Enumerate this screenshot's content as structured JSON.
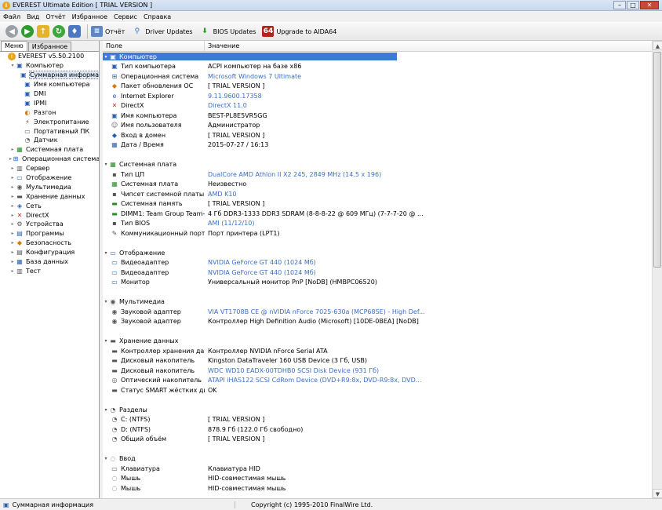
{
  "window": {
    "title": "EVEREST Ultimate Edition  [ TRIAL VERSION ]",
    "min": "–",
    "max": "□",
    "close": "✕"
  },
  "menu": [
    "Файл",
    "Вид",
    "Отчёт",
    "Избранное",
    "Сервис",
    "Справка"
  ],
  "toolbar": {
    "report": "Отчёт",
    "driver_updates": "Driver Updates",
    "bios_updates": "BIOS Updates",
    "upgrade": "Upgrade to AIDA64",
    "upgrade_icon": "64"
  },
  "left": {
    "tabs": [
      "Меню",
      "Избранное"
    ],
    "tree": [
      {
        "label": "EVEREST v5.50.2100",
        "icon": "everest-icon",
        "level": 0,
        "exp": ""
      },
      {
        "label": "Компьютер",
        "icon": "computer-icon",
        "level": 1,
        "exp": "▾"
      },
      {
        "label": "Суммарная информа",
        "icon": "summary-icon",
        "level": 2,
        "exp": "",
        "sel": true
      },
      {
        "label": "Имя компьютера",
        "icon": "computer-name-icon",
        "level": 2,
        "exp": ""
      },
      {
        "label": "DMI",
        "icon": "dmi-icon",
        "level": 2,
        "exp": ""
      },
      {
        "label": "IPMI",
        "icon": "ipmi-icon",
        "level": 2,
        "exp": ""
      },
      {
        "label": "Разгон",
        "icon": "overclock-icon",
        "level": 2,
        "exp": ""
      },
      {
        "label": "Электропитание",
        "icon": "power-icon",
        "level": 2,
        "exp": ""
      },
      {
        "label": "Портативный ПК",
        "icon": "laptop-icon",
        "level": 2,
        "exp": ""
      },
      {
        "label": "Датчик",
        "icon": "sensor-icon",
        "level": 2,
        "exp": ""
      },
      {
        "label": "Системная плата",
        "icon": "motherboard-icon",
        "level": 1,
        "exp": "▸"
      },
      {
        "label": "Операционная система",
        "icon": "os-icon",
        "level": 1,
        "exp": "▸"
      },
      {
        "label": "Сервер",
        "icon": "server-icon",
        "level": 1,
        "exp": "▸"
      },
      {
        "label": "Отображение",
        "icon": "display-icon",
        "level": 1,
        "exp": "▸"
      },
      {
        "label": "Мультимедиа",
        "icon": "multimedia-icon",
        "level": 1,
        "exp": "▸"
      },
      {
        "label": "Хранение данных",
        "icon": "storage-icon",
        "level": 1,
        "exp": "▸"
      },
      {
        "label": "Сеть",
        "icon": "network-icon",
        "level": 1,
        "exp": "▸"
      },
      {
        "label": "DirectX",
        "icon": "directx-icon",
        "level": 1,
        "exp": "▸"
      },
      {
        "label": "Устройства",
        "icon": "devices-icon",
        "level": 1,
        "exp": "▸"
      },
      {
        "label": "Программы",
        "icon": "programs-icon",
        "level": 1,
        "exp": "▸"
      },
      {
        "label": "Безопасность",
        "icon": "security-icon",
        "level": 1,
        "exp": "▸"
      },
      {
        "label": "Конфигурация",
        "icon": "config-icon",
        "level": 1,
        "exp": "▸"
      },
      {
        "label": "База данных",
        "icon": "database-icon",
        "level": 1,
        "exp": "▸"
      },
      {
        "label": "Тест",
        "icon": "test-icon",
        "level": 1,
        "exp": "▸"
      }
    ]
  },
  "table": {
    "headers": [
      "Поле",
      "Значение"
    ],
    "rows": [
      {
        "type": "groupsel",
        "field": "Компьютер",
        "icon": "computer-icon"
      },
      {
        "type": "item",
        "field": "Тип компьютера",
        "value": "ACPI компьютер на базе x86",
        "icon": "computer-icon"
      },
      {
        "type": "item",
        "field": "Операционная система",
        "value": "Microsoft Windows 7 Ultimate",
        "link": true,
        "icon": "os-icon"
      },
      {
        "type": "item",
        "field": "Пакет обновления ОС",
        "value": "[ TRIAL VERSION ]",
        "icon": "update-icon"
      },
      {
        "type": "item",
        "field": "Internet Explorer",
        "value": "9.11.9600.17358",
        "link": true,
        "icon": "ie-icon"
      },
      {
        "type": "item",
        "field": "DirectX",
        "value": "DirectX 11.0",
        "link": true,
        "icon": "directx-icon"
      },
      {
        "type": "item",
        "field": "Имя компьютера",
        "value": "BEST-PL8E5VR5GG",
        "icon": "computer-name-icon"
      },
      {
        "type": "item",
        "field": "Имя пользователя",
        "value": "Администратор",
        "icon": "user-icon"
      },
      {
        "type": "item",
        "field": "Вход в домен",
        "value": "[ TRIAL VERSION ]",
        "icon": "domain-icon"
      },
      {
        "type": "item",
        "field": "Дата / Время",
        "value": "2015-07-27 / 16:13",
        "icon": "calendar-icon"
      },
      {
        "type": "blank"
      },
      {
        "type": "group",
        "field": "Системная плата",
        "icon": "motherboard-icon"
      },
      {
        "type": "item",
        "field": "Тип ЦП",
        "value": "DualCore AMD Athlon II X2 245, 2849 MHz (14.5 x 196)",
        "link": true,
        "icon": "cpu-icon"
      },
      {
        "type": "item",
        "field": "Системная плата",
        "value": "Неизвестно",
        "icon": "motherboard-icon"
      },
      {
        "type": "item",
        "field": "Чипсет системной платы",
        "value": "AMD K10",
        "link": true,
        "icon": "chipset-icon"
      },
      {
        "type": "item",
        "field": "Системная память",
        "value": "[ TRIAL VERSION ]",
        "icon": "memory-icon"
      },
      {
        "type": "item",
        "field": "DIMM1: Team Group Team-...",
        "value": "4 Гб DDR3-1333 DDR3 SDRAM  (8-8-8-22 @ 609 МГц)  (7-7-7-20 @ ...",
        "icon": "memory-icon"
      },
      {
        "type": "item",
        "field": "Тип BIOS",
        "value": "AMI (11/12/10)",
        "link": true,
        "icon": "bios-icon"
      },
      {
        "type": "item",
        "field": "Коммуникационный порт",
        "value": "Порт принтера (LPT1)",
        "icon": "port-icon"
      },
      {
        "type": "blank"
      },
      {
        "type": "group",
        "field": "Отображение",
        "icon": "display-icon"
      },
      {
        "type": "item",
        "field": "Видеоадаптер",
        "value": "NVIDIA GeForce GT 440  (1024 Мб)",
        "link": true,
        "icon": "video-icon"
      },
      {
        "type": "item",
        "field": "Видеоадаптер",
        "value": "NVIDIA GeForce GT 440  (1024 Мб)",
        "link": true,
        "icon": "video-icon"
      },
      {
        "type": "item",
        "field": "Монитор",
        "value": "Универсальный монитор PnP [NoDB]  (HMBPC06520)",
        "icon": "monitor-icon"
      },
      {
        "type": "blank"
      },
      {
        "type": "group",
        "field": "Мультимедиа",
        "icon": "multimedia-icon"
      },
      {
        "type": "item",
        "field": "Звуковой адаптер",
        "value": "VIA VT1708B CE @ nVIDIA nForce 7025-630a (MCP68SE) - High Def...",
        "link": true,
        "icon": "audio-icon"
      },
      {
        "type": "item",
        "field": "Звуковой адаптер",
        "value": "Контроллер High Definition Audio (Microsoft) [10DE-0BEA] [NoDB]",
        "icon": "audio-icon"
      },
      {
        "type": "blank"
      },
      {
        "type": "group",
        "field": "Хранение данных",
        "icon": "storage-icon"
      },
      {
        "type": "item",
        "field": "Контроллер хранения данн...",
        "value": "Контроллер NVIDIA nForce Serial ATA",
        "icon": "controller-icon"
      },
      {
        "type": "item",
        "field": "Дисковый накопитель",
        "value": "Kingston DataTraveler 160 USB Device  (3 Гб, USB)",
        "icon": "disk-icon"
      },
      {
        "type": "item",
        "field": "Дисковый накопитель",
        "value": "WDC WD10 EADX-00TDHB0 SCSI Disk Device  (931 Гб)",
        "link": true,
        "icon": "disk-icon"
      },
      {
        "type": "item",
        "field": "Оптический накопитель",
        "value": "ATAPI iHAS122 SCSI CdRom Device  (DVD+R9:8x, DVD-R9:8x, DVD...",
        "link": true,
        "icon": "optical-icon"
      },
      {
        "type": "item",
        "field": "Статус SMART жёстких дис...",
        "value": "OK",
        "icon": "smart-icon"
      },
      {
        "type": "blank"
      },
      {
        "type": "group",
        "field": "Разделы",
        "icon": "partitions-icon"
      },
      {
        "type": "item",
        "field": "C: (NTFS)",
        "value": "[ TRIAL VERSION ]",
        "icon": "partition-icon"
      },
      {
        "type": "item",
        "field": "D: (NTFS)",
        "value": "878.9 Гб (122.0 Гб свободно)",
        "icon": "partition-icon"
      },
      {
        "type": "item",
        "field": "Общий объём",
        "value": "[ TRIAL VERSION ]",
        "icon": "partition-icon"
      },
      {
        "type": "blank"
      },
      {
        "type": "group",
        "field": "Ввод",
        "icon": "input-icon"
      },
      {
        "type": "item",
        "field": "Клавиатура",
        "value": "Клавиатура HID",
        "icon": "keyboard-icon"
      },
      {
        "type": "item",
        "field": "Мышь",
        "value": "HID-совместимая мышь",
        "icon": "mouse-icon"
      },
      {
        "type": "item",
        "field": "Мышь",
        "value": "HID-совместимая мышь",
        "icon": "mouse-icon"
      }
    ]
  },
  "statusbar": {
    "left": "Суммарная информация",
    "right": "Copyright (c) 1995-2010 FinalWire Ltd."
  },
  "colors": {
    "selection": "#3e7bd6",
    "link": "#3b6fc7"
  }
}
